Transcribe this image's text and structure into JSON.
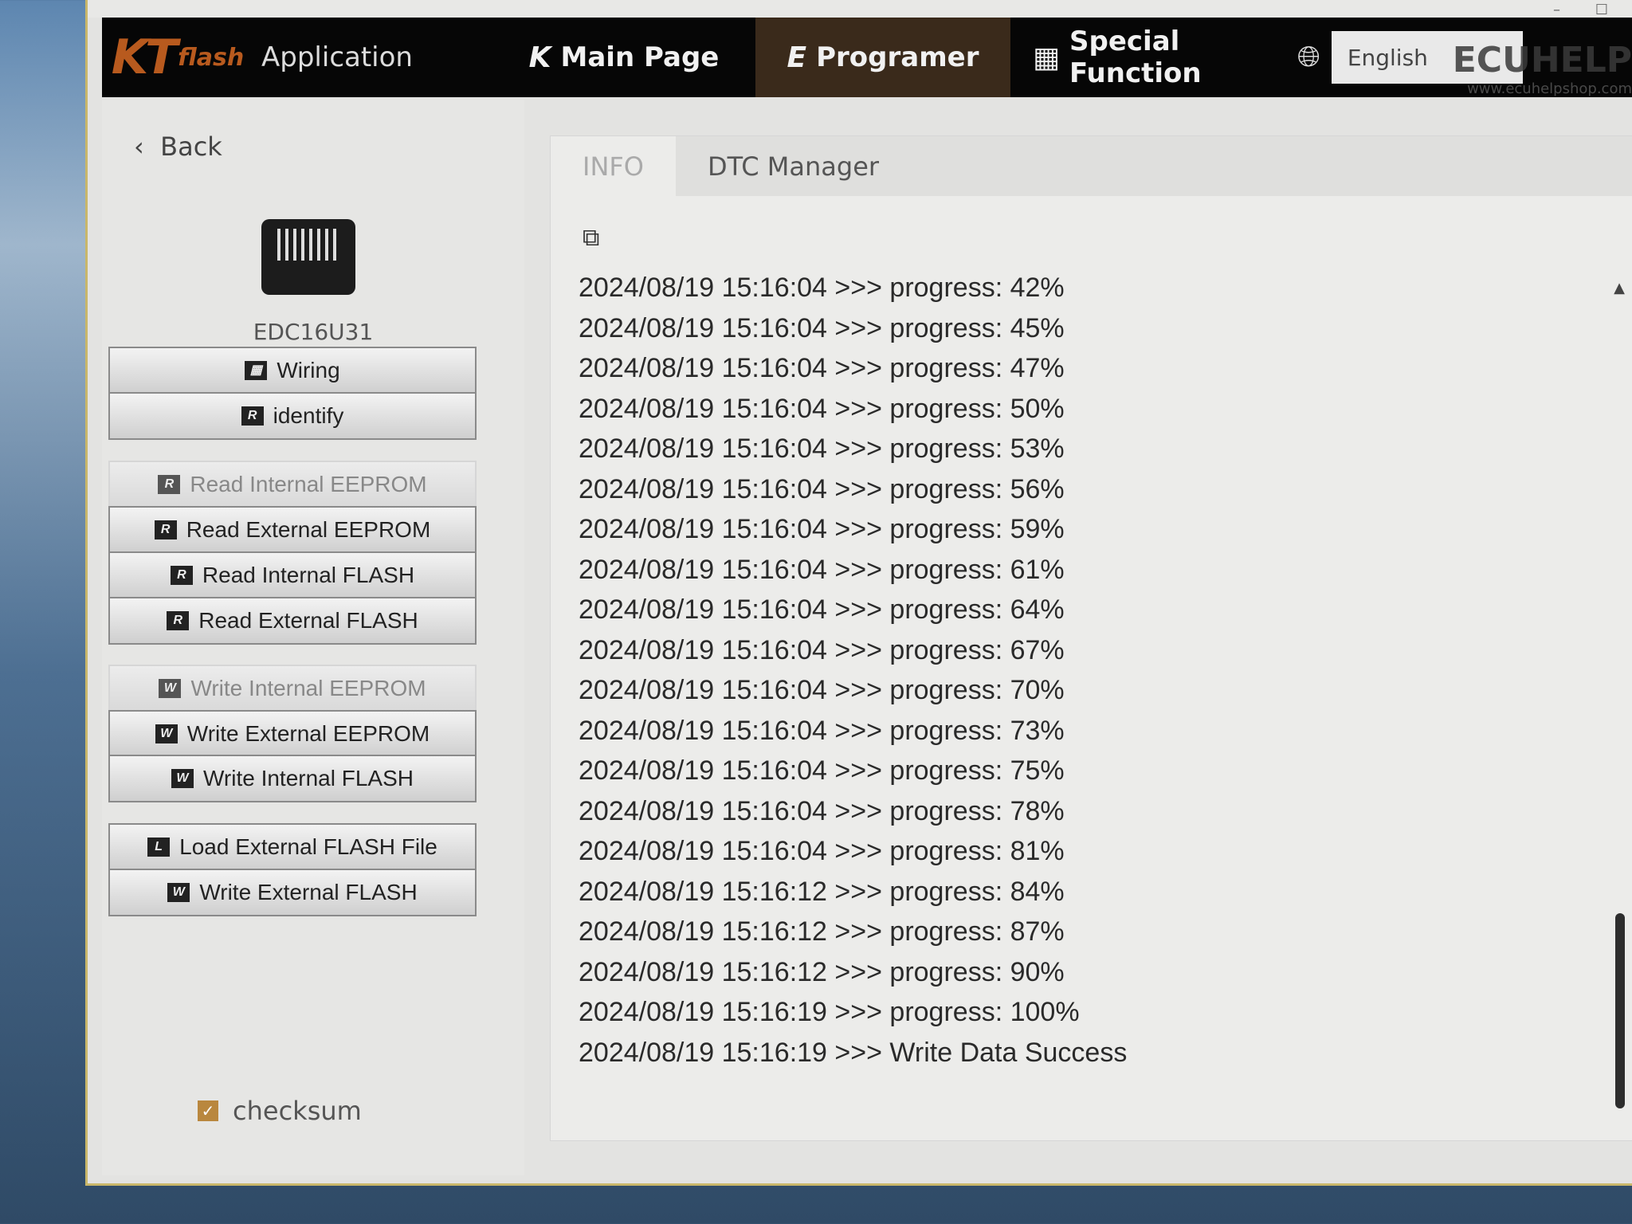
{
  "header": {
    "logo": "KTflash",
    "app_label": "Application",
    "nav": [
      {
        "icon": "K",
        "label": "Main Page"
      },
      {
        "icon": "E",
        "label": "Programer",
        "active": true
      },
      {
        "icon": "grid",
        "label": "Special Function"
      }
    ],
    "language": "English",
    "watermark": "ECUHELP",
    "watermark_url": "www.ecuhelpshop.com"
  },
  "sidebar": {
    "back_label": "Back",
    "ecu_name": "EDC16U31",
    "buttons": [
      {
        "icon": "grid",
        "label": "Wiring",
        "enabled": true
      },
      {
        "icon": "R",
        "label": "identify",
        "enabled": true
      },
      {
        "icon": "R",
        "label": "Read Internal EEPROM",
        "enabled": false
      },
      {
        "icon": "R",
        "label": "Read External EEPROM",
        "enabled": true
      },
      {
        "icon": "R",
        "label": "Read Internal FLASH",
        "enabled": true
      },
      {
        "icon": "R",
        "label": "Read External FLASH",
        "enabled": true
      },
      {
        "icon": "W",
        "label": "Write Internal EEPROM",
        "enabled": false
      },
      {
        "icon": "W",
        "label": "Write External EEPROM",
        "enabled": true
      },
      {
        "icon": "W",
        "label": "Write Internal FLASH",
        "enabled": true
      },
      {
        "icon": "L",
        "label": "Load External FLASH File",
        "enabled": true
      },
      {
        "icon": "W",
        "label": "Write External FLASH",
        "enabled": true
      }
    ],
    "checksum_label": "checksum",
    "checksum_checked": true
  },
  "main": {
    "tabs": [
      {
        "label": "INFO",
        "active": true
      },
      {
        "label": "DTC Manager"
      }
    ],
    "log": [
      "2024/08/19 15:16:04 >>> progress: 42%",
      "2024/08/19 15:16:04 >>> progress: 45%",
      "2024/08/19 15:16:04 >>> progress: 47%",
      "2024/08/19 15:16:04 >>> progress: 50%",
      "2024/08/19 15:16:04 >>> progress: 53%",
      "2024/08/19 15:16:04 >>> progress: 56%",
      "2024/08/19 15:16:04 >>> progress: 59%",
      "2024/08/19 15:16:04 >>> progress: 61%",
      "2024/08/19 15:16:04 >>> progress: 64%",
      "2024/08/19 15:16:04 >>> progress: 67%",
      "2024/08/19 15:16:04 >>> progress: 70%",
      "2024/08/19 15:16:04 >>> progress: 73%",
      "2024/08/19 15:16:04 >>> progress: 75%",
      "2024/08/19 15:16:04 >>> progress: 78%",
      "2024/08/19 15:16:04 >>> progress: 81%",
      "2024/08/19 15:16:12 >>> progress: 84%",
      "2024/08/19 15:16:12 >>> progress: 87%",
      "2024/08/19 15:16:12 >>> progress: 90%",
      "2024/08/19 15:16:19 >>> progress: 100%",
      "2024/08/19 15:16:19 >>> Write Data Success"
    ]
  },
  "colors": {
    "header_bg": "#060606",
    "active_tab": "#3a2a1b",
    "logo": "#b85a1e",
    "checkbox": "#b9873e"
  }
}
